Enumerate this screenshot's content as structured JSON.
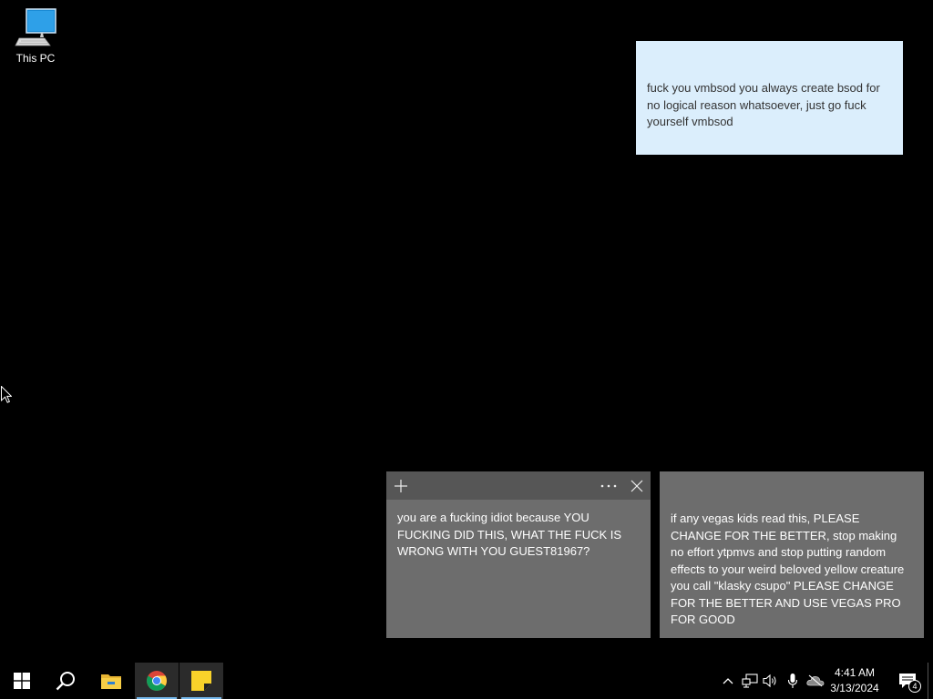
{
  "desktop": {
    "icons": [
      {
        "label": "This PC",
        "icon": "this-pc-icon"
      }
    ]
  },
  "sticky_notes": [
    {
      "color": "#dbeefc",
      "text": "fuck you vmbsod you always create bsod for no logical reason whatsoever, just go fuck yourself vmbsod"
    },
    {
      "color": "#6d6d6d",
      "header_buttons": [
        "plus-icon",
        "more-icon",
        "close-icon"
      ],
      "text": "you are a fucking idiot because YOU FUCKING DID THIS, WHAT THE FUCK IS WRONG WITH YOU GUEST81967?"
    },
    {
      "color": "#6d6d6d",
      "text": "if any vegas kids read this, PLEASE CHANGE FOR THE BETTER, stop making no effort ytpmvs and stop putting random effects to your weird beloved yellow creature you call  \"klasky csupo\" PLEASE CHANGE FOR THE BETTER AND USE VEGAS PRO FOR GOOD"
    }
  ],
  "taskbar": {
    "start_icon": "windows-start-icon",
    "search_icon": "search-icon",
    "apps": [
      {
        "name": "file-explorer",
        "icon": "folder-icon",
        "active": false
      },
      {
        "name": "chrome",
        "icon": "chrome-icon",
        "active": true
      },
      {
        "name": "sticky-notes",
        "icon": "sticky-notes-icon",
        "active": true
      }
    ],
    "tray_icons": [
      "chevron-up-icon",
      "network-icon",
      "volume-icon",
      "microphone-icon",
      "onedrive-icon"
    ],
    "clock": {
      "time": "4:41 AM",
      "date": "3/13/2024"
    },
    "notifications_count": "4",
    "accent_color": "#76b9ed"
  }
}
